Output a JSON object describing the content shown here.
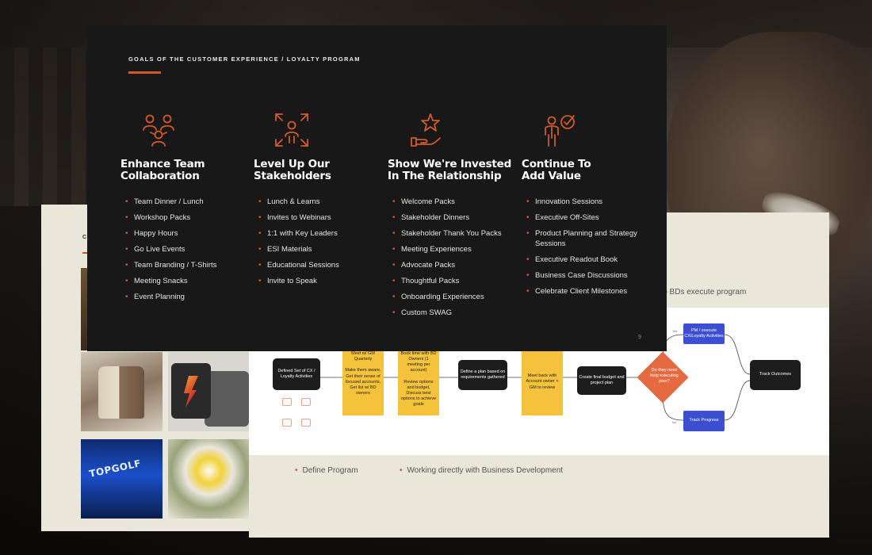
{
  "front_slide": {
    "eyebrow": "GOALS OF THE CUSTOMER EXPERIENCE / LOYALTY PROGRAM",
    "page_number": "9",
    "accent_color": "#d05a2b",
    "columns": [
      {
        "icon": "team-collaboration-icon",
        "title_line1": "Enhance Team",
        "title_line2": "Collaboration",
        "items": [
          "Team Dinner / Lunch",
          "Workshop Packs",
          "Happy Hours",
          "Go Live Events",
          "Team Branding / T-Shirts",
          "Meeting Snacks",
          "Event Planning"
        ]
      },
      {
        "icon": "level-up-stakeholder-icon",
        "title_line1": "Level Up Our",
        "title_line2": "Stakeholders",
        "items": [
          "Lunch & Learns",
          "Invites to Webinars",
          "1:1 with Key Leaders",
          "ESI Materials",
          "Educational Sessions",
          "Invite to Speak"
        ]
      },
      {
        "icon": "hand-star-icon",
        "title_line1": "Show We're Invested",
        "title_line2": "In The Relationship",
        "items": [
          "Welcome Packs",
          "Stakeholder Dinners",
          "Stakeholder Thank You Packs",
          "Meeting Experiences",
          "Advocate Packs",
          "Thoughtful Packs",
          "Onboarding Experiences",
          "Custom SWAG"
        ]
      },
      {
        "icon": "person-target-icon",
        "title_line1": "Continue To",
        "title_line2": "Add Value",
        "items": [
          "Innovation Sessions",
          "Executive Off-Sites",
          "Product Planning and Strategy Sessions",
          "Executive Readout Book",
          "Business Case Discussions",
          "Celebrate Client Milestones"
        ]
      }
    ]
  },
  "left_slide": {
    "heading": "C",
    "photos": [
      "leather-bag-photo",
      "tshirts-photo",
      "topgolf-photo",
      "flowers-photo"
    ],
    "topgolf_sign": "TOPGOLF"
  },
  "right_slide": {
    "subtitle_fragment": "lp BDs execute program",
    "flow": {
      "start": "Defined Set of CX / Loyalty Activities",
      "sticky1": "Meet w/ GM Quarterly\n\nMake them aware, Get their sense of focused accounts, Get list w/ BD owners",
      "sticky2": "Book time with BD Owners (1 meeting per account)\n\nReview options and budget, Discuss best options to achieve goals",
      "plan": "Define a plan based on requirements gathered",
      "sticky3": "Meet back with Account owner + GM to review",
      "budget": "Create final budget and project plan",
      "decision": "Do they need help executing plan?",
      "yes_box": "PM / execute CX/Loyalty Activities",
      "no_box": "Track Progress",
      "outcome": "Track Outcomes",
      "yes_label": "Yes",
      "no_label": "No"
    },
    "bullets": [
      "Define Program",
      "Working directly with Business Development"
    ]
  }
}
